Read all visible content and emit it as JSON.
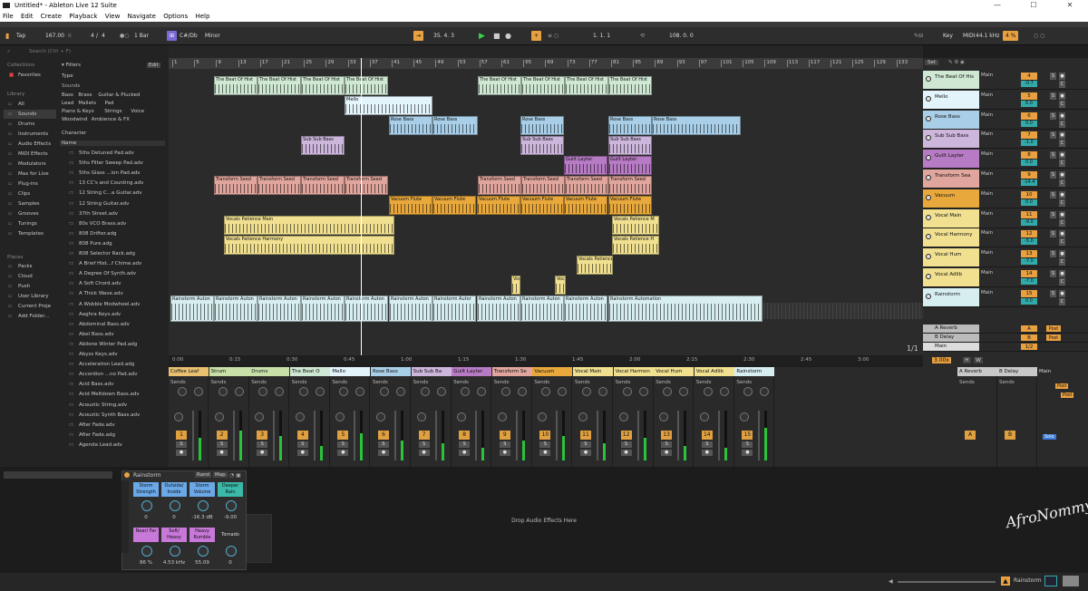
{
  "window": {
    "title": "Untitled* - Ableton Live 12 Suite",
    "minimize": "—",
    "maximize": "☐",
    "close": "✕"
  },
  "menu": [
    "File",
    "Edit",
    "Create",
    "Playback",
    "View",
    "Navigate",
    "Options",
    "Help"
  ],
  "transport": {
    "tap": "Tap",
    "tempo": "167.00",
    "sig_num": "4",
    "sig_den": "4",
    "quant": "1 Bar",
    "key_root": "C#/Db",
    "scale": "Minor",
    "position": "35.  4.  3",
    "loop_start": "1.  1.  1",
    "loop_len": "108.  0.  0",
    "key_label": "Key",
    "midi_label": "MIDI",
    "sample_rate": "44.1 kHz",
    "cpu": "4 %"
  },
  "browser": {
    "search": "Search (Ctrl + F)",
    "collections_title": "Collections",
    "favorites": "Favorites",
    "filters": "Filters",
    "edit": "Edit",
    "type": "Type",
    "sounds_filter": "Sounds",
    "sound_tags": [
      [
        "Bass",
        "Brass",
        "Guitar & Plucked"
      ],
      [
        "Lead",
        "Mallets",
        "Pad"
      ],
      [
        "Piano & Keys",
        "Strings",
        "Voice"
      ],
      [
        "Woodwind",
        "Ambience & FX"
      ]
    ],
    "character": "Character",
    "name_col": "Name",
    "library_title": "Library",
    "library": [
      "All",
      "Sounds",
      "Drums",
      "Instruments",
      "Audio Effects",
      "MIDI Effects",
      "Modulators",
      "Max for Live",
      "Plug-ins",
      "Clips",
      "Samples",
      "Grooves",
      "Tunings",
      "Templates"
    ],
    "places_title": "Places",
    "places": [
      "Packs",
      "Cloud",
      "Push",
      "User Library",
      "Current Proje",
      "Add Folder..."
    ],
    "files": [
      "5ths Detuned Pad.adv",
      "5ths Filter Sweep Pad.adv",
      "5ths Glass ...ion Pad.adv",
      "13 CC's and Counting.adv",
      "12 String C...a Guitar.adv",
      "12 String Guitar.adv",
      "37th Street.adv",
      "80s VCO Brass.adv",
      "808 Drifter.adg",
      "808 Pure.adg",
      "808 Selector Rack.adg",
      "A Brief Hist...f Chime.adv",
      "A Degree Of Synth.adv",
      "A Soft Chord.adv",
      "A Thick Wave.adv",
      "A Wobble Modwheel.adv",
      "Aaghra Keys.adv",
      "Abdominal Bass.adv",
      "Abel Bass.adv",
      "Abilene Winter Pad.adg",
      "Abyss Keys.adv",
      "Acceleration Lead.adg",
      "Accordion ...no Pad.adv",
      "Acid Bass.adv",
      "Acid Meltdown Bass.adv",
      "Acoustic String.adv",
      "Acoustic Synth Bass.adv",
      "After Fade.adv",
      "After Fade.adg",
      "Agenda Lead.adv"
    ]
  },
  "ruler": [
    "1",
    "5",
    "9",
    "13",
    "17",
    "21",
    "25",
    "29",
    "33",
    "37",
    "41",
    "45",
    "49",
    "53",
    "57",
    "61",
    "65",
    "69",
    "73",
    "77",
    "81",
    "85",
    "89",
    "93",
    "97",
    "101",
    "105",
    "109",
    "113",
    "117",
    "121",
    "125",
    "129",
    "133"
  ],
  "timeline": [
    "0:00",
    "0:15",
    "0:30",
    "0:45",
    "1:00",
    "1:15",
    "1:30",
    "1:45",
    "2:00",
    "2:15",
    "2:30",
    "2:45",
    "3:00"
  ],
  "set": {
    "set_btn": "Set",
    "page": "1/1",
    "zoom": "3.00x",
    "h": "H",
    "w": "W"
  },
  "tracks": [
    {
      "name": "The Beat Of His",
      "color": "#cfe8d4",
      "num": "4",
      "vol": "-0.7",
      "out": "Main"
    },
    {
      "name": "Mello",
      "color": "#e4f4fb",
      "num": "5",
      "vol": "6.0",
      "out": "Main"
    },
    {
      "name": "Rose Bass",
      "color": "#a9cfe8",
      "num": "6",
      "vol": "0.0",
      "out": "Main"
    },
    {
      "name": "Sub Sub Bass",
      "color": "#cdb6dc",
      "num": "7",
      "vol": "-1.0",
      "out": "Main"
    },
    {
      "name": "Guilt Layter",
      "color": "#b77ac4",
      "num": "8",
      "vol": "0.0",
      "out": "Main"
    },
    {
      "name": "Transform Sea",
      "color": "#e0a59c",
      "num": "9",
      "vol": "-14.4",
      "out": "Main"
    },
    {
      "name": "Vacuum",
      "color": "#e8a83c",
      "num": "10",
      "vol": "0.0",
      "out": "Main"
    },
    {
      "name": "Vocal Main",
      "color": "#f0e090",
      "num": "11",
      "vol": "-9.0",
      "out": "Main"
    },
    {
      "name": "Vocal Harmony",
      "color": "#f0e090",
      "num": "12",
      "vol": "-5.0",
      "out": "Main"
    },
    {
      "name": "Vocal Hum",
      "color": "#f0e090",
      "num": "13",
      "vol": "-7.0",
      "out": "Main"
    },
    {
      "name": "Vocal Adlib",
      "color": "#f0e090",
      "num": "14",
      "vol": "-7.0",
      "out": "Main"
    },
    {
      "name": "Rainstorm",
      "color": "#d7eef0",
      "num": "15",
      "vol": "0.0",
      "out": "Main"
    }
  ],
  "returns": [
    {
      "name": "A Reverb",
      "num": "A",
      "post": "Post"
    },
    {
      "name": "B Delay",
      "num": "B",
      "post": "Post"
    },
    {
      "name": "Main",
      "num": "1/2",
      "post": ""
    }
  ],
  "clips": [
    {
      "lane": 0,
      "items": [
        [
          "The Beat Of Hist",
          50,
          48
        ],
        [
          "The Beat Of Hist",
          98,
          48
        ],
        [
          "The Beat Of Hist",
          146,
          48
        ],
        [
          "The Beat Of Hist",
          194,
          48
        ],
        [
          "The Beat Of Hist",
          341,
          48
        ],
        [
          "The Beat Of Hist",
          389,
          48
        ],
        [
          "The Beat Of Hist",
          437,
          48
        ],
        [
          "The Beat Of Hist",
          485,
          48
        ]
      ]
    },
    {
      "lane": 1,
      "items": [
        [
          "Mello",
          194,
          97
        ]
      ]
    },
    {
      "lane": 2,
      "items": [
        [
          "Rose Bass",
          243,
          48
        ],
        [
          "Rose Bass",
          291,
          50
        ],
        [
          "Rose Bass",
          388,
          48
        ],
        [
          "Rose Bass",
          485,
          48
        ],
        [
          "Rose Bass",
          533,
          98
        ]
      ]
    },
    {
      "lane": 3,
      "items": [
        [
          "Sub Sub Bass",
          146,
          48
        ],
        [
          "Sub Sub Bass",
          388,
          48
        ],
        [
          "Sub Sub Bass",
          485,
          48
        ]
      ]
    },
    {
      "lane": 4,
      "items": [
        [
          "Guilt Layter",
          436,
          48
        ],
        [
          "Guilt Layter",
          485,
          48
        ]
      ]
    },
    {
      "lane": 5,
      "items": [
        [
          "Transform Seed",
          50,
          48
        ],
        [
          "Transform Seed",
          98,
          48
        ],
        [
          "Transform Seed",
          146,
          48
        ],
        [
          "Transform Seed",
          194,
          48
        ],
        [
          "Transform Seed",
          341,
          48
        ],
        [
          "Transform Seed",
          389,
          48
        ],
        [
          "Transform Seed",
          437,
          48
        ],
        [
          "Transform Seed",
          485,
          48
        ]
      ]
    },
    {
      "lane": 6,
      "items": [
        [
          "Vacuum Flute",
          243,
          48
        ],
        [
          "Vacuum Flute",
          291,
          48
        ],
        [
          "Vacuum Flute",
          340,
          48
        ],
        [
          "Vacuum Flute",
          388,
          48
        ],
        [
          "Vacuum Flute",
          436,
          48
        ],
        [
          "Vacuum Flute",
          485,
          48
        ]
      ]
    },
    {
      "lane": 7,
      "items": [
        [
          "Vocals Patience Main",
          61,
          188
        ],
        [
          "Vocals Patience M",
          489,
          52
        ]
      ]
    },
    {
      "lane": 8,
      "items": [
        [
          "Vocals Patience Harmony",
          61,
          188
        ],
        [
          "Vocals Patience H",
          489,
          52
        ]
      ]
    },
    {
      "lane": 9,
      "items": [
        [
          "Vocals Patience",
          450,
          40
        ]
      ]
    },
    {
      "lane": 10,
      "items": [
        [
          "Voc",
          378,
          10
        ],
        [
          "Voc",
          426,
          12
        ]
      ]
    },
    {
      "lane": 11,
      "items": [
        [
          "Rainstorm Auton",
          2,
          48
        ],
        [
          "Rainstorm Auton",
          50,
          48
        ],
        [
          "Rainstorm Auton",
          98,
          48
        ],
        [
          "Rainstorm Auton",
          146,
          48
        ],
        [
          "Rainstorm Auton",
          194,
          48
        ],
        [
          "Rainstorm Auton",
          243,
          48
        ],
        [
          "Rainstorm Autor",
          291,
          48
        ],
        [
          "Rainstorm Auton",
          340,
          48
        ],
        [
          "Rainstorm Auton",
          388,
          48
        ],
        [
          "Rainstorm Auton",
          436,
          48
        ],
        [
          "Rainstorm Automation",
          485,
          170
        ]
      ]
    }
  ],
  "mixer": {
    "sends": "Sends",
    "channels": [
      {
        "name": "Coffee Leaf",
        "color": "#e8c070",
        "num": "1"
      },
      {
        "name": "Strum",
        "color": "#c8e0a8",
        "num": "2"
      },
      {
        "name": "Drums",
        "color": "#c8e0a8",
        "num": "3"
      },
      {
        "name": "The Beat O",
        "color": "#cfe8d4",
        "num": "4"
      },
      {
        "name": "Mello",
        "color": "#e4f4fb",
        "num": "5"
      },
      {
        "name": "Rose Bass",
        "color": "#a9cfe8",
        "num": "6"
      },
      {
        "name": "Sub Sub Ba",
        "color": "#cdb6dc",
        "num": "7"
      },
      {
        "name": "Guilt Layter",
        "color": "#b77ac4",
        "num": "8"
      },
      {
        "name": "Transform Se",
        "color": "#e0a59c",
        "num": "9"
      },
      {
        "name": "Vacuum",
        "color": "#e8a83c",
        "num": "10"
      },
      {
        "name": "Vocal Main",
        "color": "#f0e090",
        "num": "11"
      },
      {
        "name": "Vocal Harmon",
        "color": "#f0e090",
        "num": "12"
      },
      {
        "name": "Vocal Hum",
        "color": "#f0e090",
        "num": "13"
      },
      {
        "name": "Vocal Adlib",
        "color": "#f0e090",
        "num": "14"
      },
      {
        "name": "Rainstorm",
        "color": "#d7eef0",
        "num": "15"
      }
    ],
    "return_a": "A Reverb",
    "return_b": "B Delay",
    "main": "Main",
    "post": "Post",
    "solo": "Solo"
  },
  "device": {
    "name": "Rainstorm",
    "rand": "Rand",
    "map": "Map",
    "macros": [
      {
        "label": "Storm Strength",
        "value": "0",
        "color": "#6aa8e8"
      },
      {
        "label": "Outside/ Inside",
        "value": "0",
        "color": "#6aa8e8"
      },
      {
        "label": "Storm Volume",
        "value": "-16.3 dB",
        "color": "#6aa8e8"
      },
      {
        "label": "Deeper Rain",
        "value": "-9.00",
        "color": "#3ab8a8"
      },
      {
        "label": "Near/ Far",
        "value": "86 %",
        "color": "#c878d8"
      },
      {
        "label": "Soft/ Heavy",
        "value": "4.53 kHz",
        "color": "#c878d8"
      },
      {
        "label": "Heavy Rumble",
        "value": "55.09",
        "color": "#c878d8"
      },
      {
        "label": "Tornado",
        "value": "0",
        "color": "#2d2d2d"
      }
    ]
  },
  "drop_text": "Drop Audio Effects Here",
  "status": {
    "track": "Rainstorm",
    "signature": "AfroNommy"
  }
}
